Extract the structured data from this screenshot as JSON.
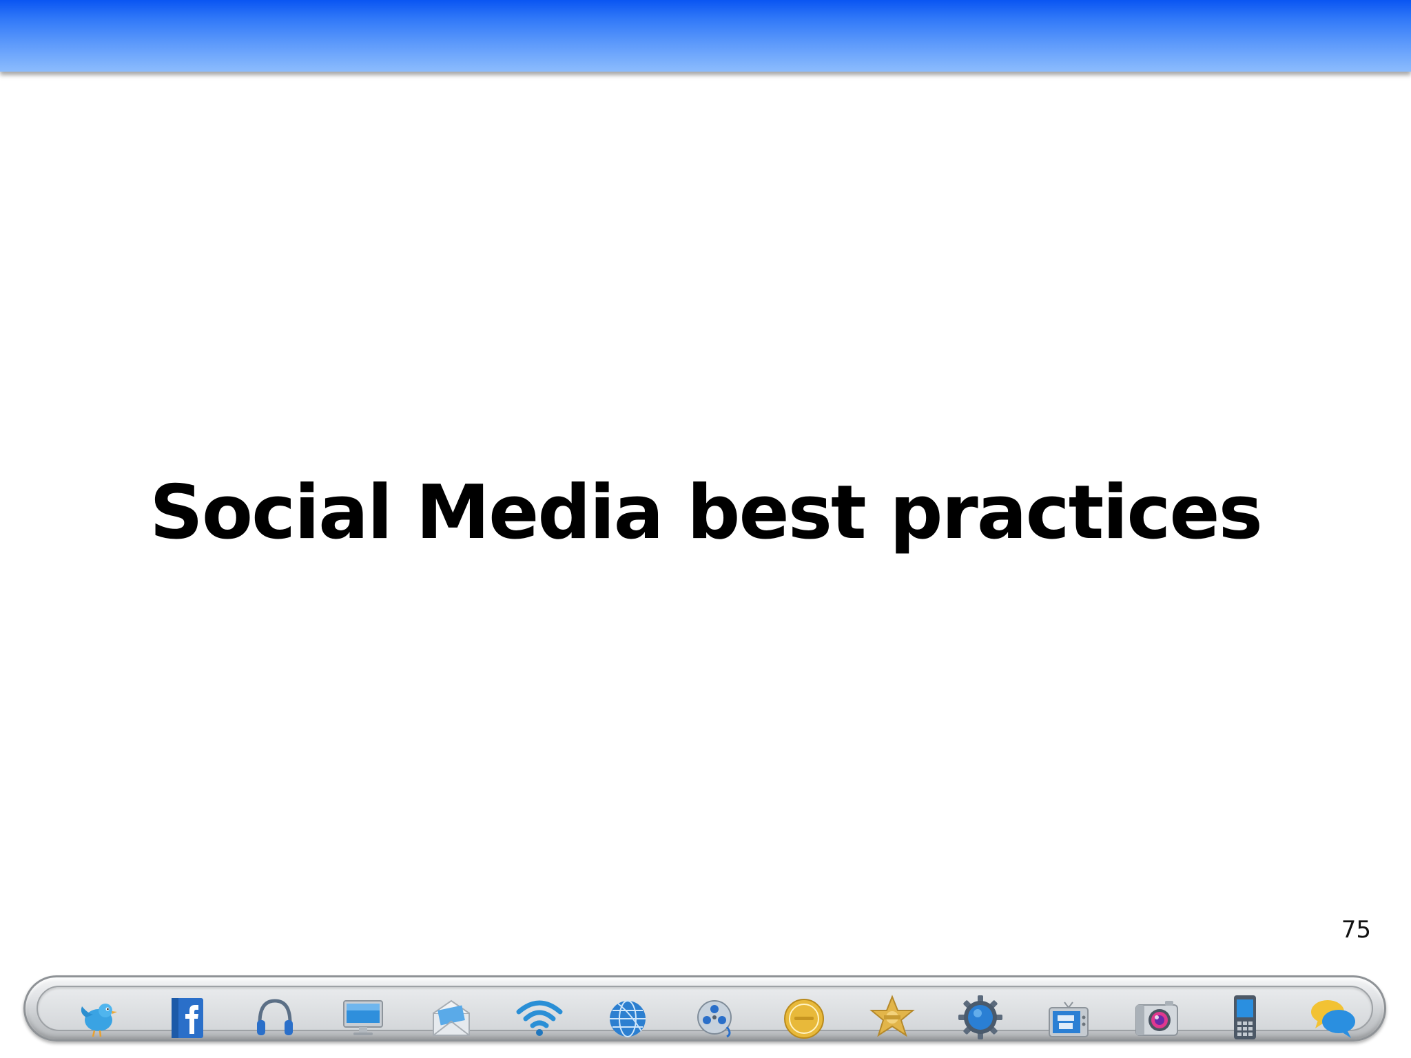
{
  "slide": {
    "title": "Social Media best practices",
    "page_number": "75"
  },
  "colors": {
    "band_top": "#0a55f2",
    "band_bottom": "#8cbcfd",
    "icon_blue": "#2a8fd6",
    "icon_gold": "#e8b93a"
  },
  "dock": {
    "icons": [
      "twitter-bird-icon",
      "facebook-icon",
      "headphones-icon",
      "monitor-icon",
      "mail-envelope-icon",
      "wifi-icon",
      "globe-icon",
      "film-reel-icon",
      "gold-button-icon",
      "sheriff-badge-icon",
      "gear-icon",
      "youtube-tv-icon",
      "camera-icon",
      "mobile-phone-icon",
      "chat-bubbles-icon"
    ]
  }
}
